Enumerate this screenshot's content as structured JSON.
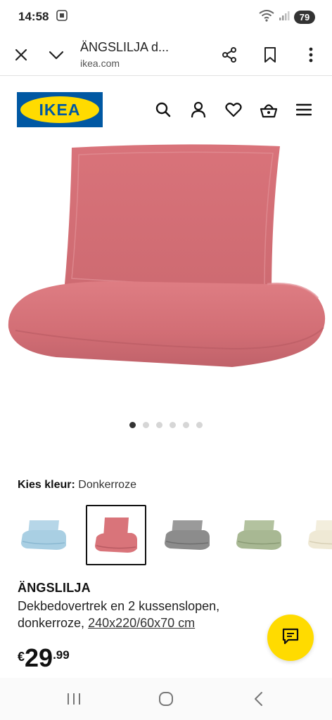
{
  "status_bar": {
    "time": "14:58",
    "battery": "79"
  },
  "browser": {
    "title": "ÄNGSLILJA d...",
    "domain": "ikea.com",
    "icons": [
      "close-icon",
      "chevron-down-icon",
      "share-icon",
      "bookmark-icon",
      "more-vert-icon"
    ]
  },
  "header": {
    "logo_text": "IKEA",
    "brand_blue": "#0058a3",
    "brand_yellow": "#ffdb00",
    "icons": [
      "search-icon",
      "account-icon",
      "heart-icon",
      "basket-icon",
      "menu-icon"
    ]
  },
  "product_image": {
    "color": "#d9747a",
    "carousel_total": 6,
    "carousel_active": 1
  },
  "color_chooser": {
    "label": "Kies kleur:",
    "value": "Donkerroze",
    "swatches": [
      {
        "name": "Lichtblauw",
        "color": "#a9cfe3",
        "selected": false
      },
      {
        "name": "Donkerroze",
        "color": "#d9747a",
        "selected": true
      },
      {
        "name": "Grijs",
        "color": "#8c8c8c",
        "selected": false
      },
      {
        "name": "Groen",
        "color": "#a8b893",
        "selected": false
      },
      {
        "name": "Wit",
        "color": "#efe9d5",
        "selected": false
      }
    ]
  },
  "product": {
    "name": "ÄNGSLILJA",
    "description": "Dekbedovertrek en 2 kussenslopen, donkerroze, ",
    "size": "240x220/60x70 cm",
    "price_currency": "€",
    "price_integer": "29",
    "price_decimal": ".99"
  }
}
